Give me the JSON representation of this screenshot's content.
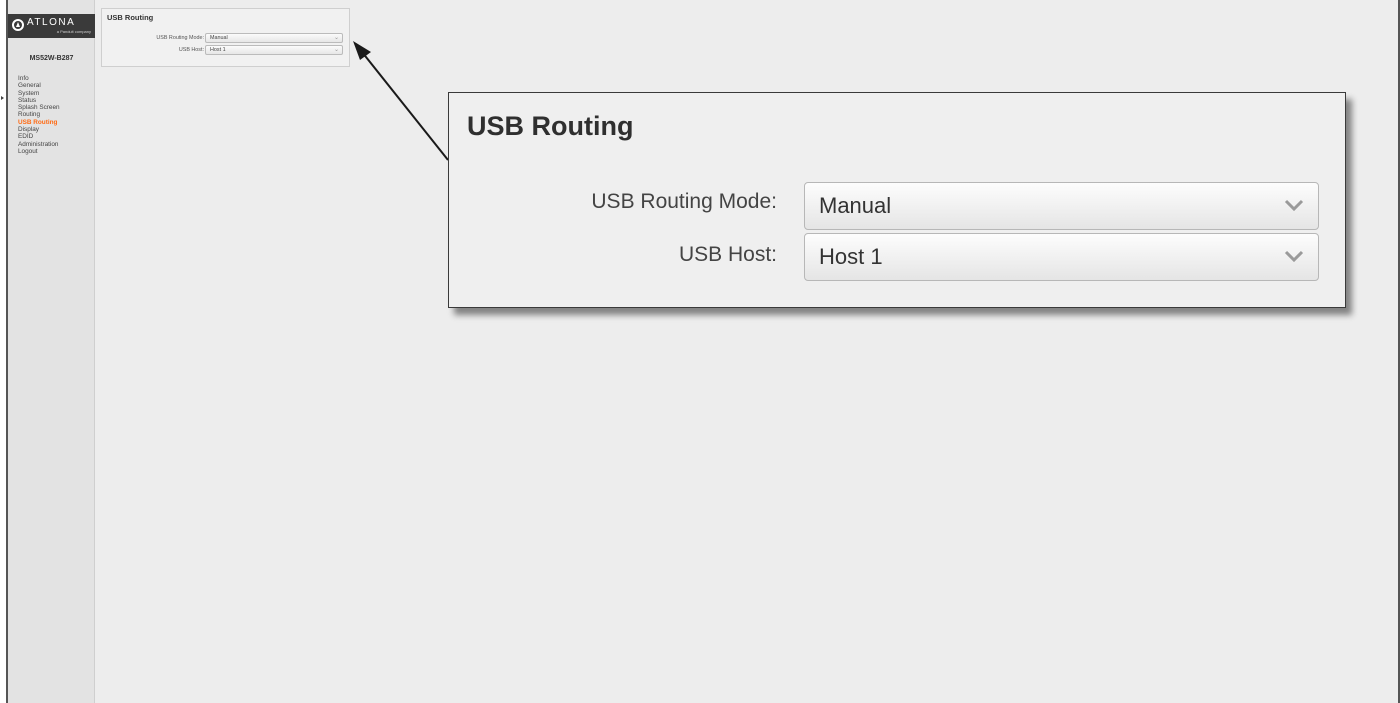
{
  "brand": {
    "name": "ATLONA",
    "tagline": "a Panduit company"
  },
  "device": {
    "name": "MS52W-B287"
  },
  "sidebar": {
    "items": [
      {
        "label": "Info",
        "active": false
      },
      {
        "label": "General",
        "active": false
      },
      {
        "label": "System",
        "active": false
      },
      {
        "label": "Status",
        "active": false
      },
      {
        "label": "Splash Screen",
        "active": false
      },
      {
        "label": "Routing",
        "active": false
      },
      {
        "label": "USB Routing",
        "active": true
      },
      {
        "label": "Display",
        "active": false
      },
      {
        "label": "EDID",
        "active": false
      },
      {
        "label": "Administration",
        "active": false
      },
      {
        "label": "Logout",
        "active": false
      }
    ]
  },
  "panel": {
    "title": "USB Routing",
    "routing_mode_label": "USB Routing Mode:",
    "routing_mode_value": "Manual",
    "usb_host_label": "USB Host:",
    "usb_host_value": "Host 1"
  },
  "colors": {
    "accent": "#ff6a13",
    "sidebar_bg": "#e3e3e3",
    "page_bg": "#ededed"
  },
  "icons": {
    "select_arrow": "chevron-down-icon",
    "logo": "atlona-logo-icon"
  }
}
